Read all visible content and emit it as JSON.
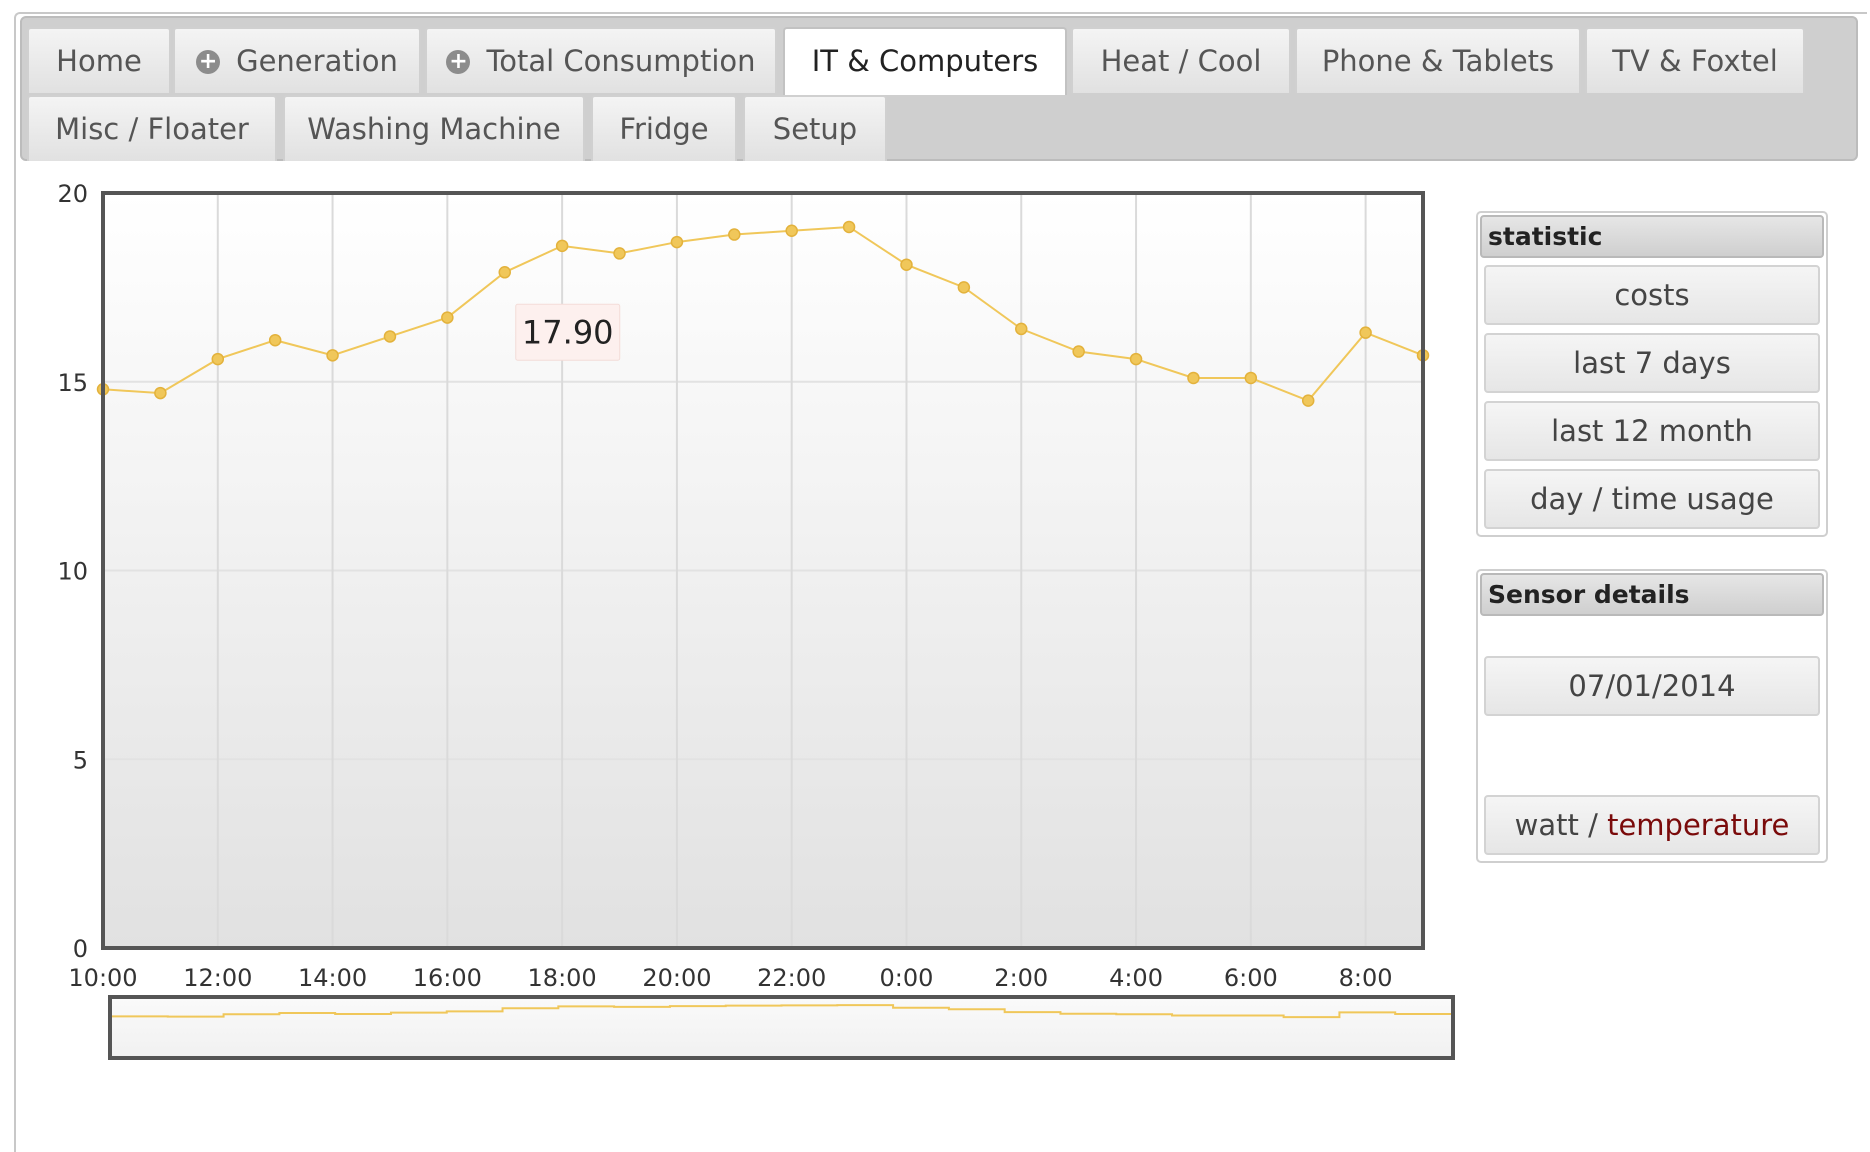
{
  "tabs": [
    {
      "label": "Home",
      "icon": null,
      "active": false
    },
    {
      "label": "Generation",
      "icon": "plus-circle-icon",
      "active": false
    },
    {
      "label": "Total Consumption",
      "icon": "plus-circle-icon",
      "active": false
    },
    {
      "label": "IT & Computers",
      "icon": null,
      "active": true
    },
    {
      "label": "Heat / Cool",
      "icon": null,
      "active": false
    },
    {
      "label": "Phone & Tablets",
      "icon": null,
      "active": false
    },
    {
      "label": "TV & Foxtel",
      "icon": null,
      "active": false
    },
    {
      "label": "Misc / Floater",
      "icon": null,
      "active": false
    },
    {
      "label": "Washing Machine",
      "icon": null,
      "active": false
    },
    {
      "label": "Fridge",
      "icon": null,
      "active": false
    },
    {
      "label": "Setup",
      "icon": null,
      "active": false
    }
  ],
  "statistic": {
    "title": "statistic",
    "buttons": [
      "costs",
      "last 7 days",
      "last 12 month",
      "day / time usage"
    ]
  },
  "sensor": {
    "title": "Sensor details",
    "date": "07/01/2014",
    "unit_watt": "watt",
    "unit_sep": " / ",
    "unit_temperature": "temperature"
  },
  "colors": {
    "series": "#f0c75a",
    "temperature": "#7a0a0a"
  },
  "chart_data": {
    "type": "line",
    "title": "",
    "xlabel": "",
    "ylabel": "",
    "ylim": [
      0,
      20
    ],
    "yticks": [
      0,
      5,
      10,
      15,
      20
    ],
    "x": [
      0,
      1,
      2,
      3,
      4,
      5,
      6,
      7,
      8,
      9,
      10,
      11,
      12,
      13,
      14,
      15,
      16,
      17,
      18,
      19,
      20,
      21,
      22,
      23
    ],
    "xlim": [
      0,
      23
    ],
    "xtick_labels": [
      "10:00",
      "12:00",
      "14:00",
      "16:00",
      "18:00",
      "20:00",
      "22:00",
      "0:00",
      "2:00",
      "4:00",
      "6:00",
      "8:00"
    ],
    "xtick_positions": [
      0,
      2,
      4,
      6,
      8,
      10,
      12,
      14,
      16,
      18,
      20,
      22
    ],
    "series": [
      {
        "name": "",
        "values": [
          14.8,
          14.7,
          15.6,
          16.1,
          15.7,
          16.2,
          16.7,
          17.9,
          18.6,
          18.4,
          18.7,
          18.9,
          19.0,
          19.1,
          18.1,
          17.5,
          16.4,
          15.8,
          15.6,
          15.1,
          15.1,
          14.5,
          16.3,
          15.7
        ]
      }
    ],
    "tooltip": {
      "index": 7,
      "text": "17.90"
    },
    "grid": true,
    "legend": "none",
    "navigator": true
  }
}
